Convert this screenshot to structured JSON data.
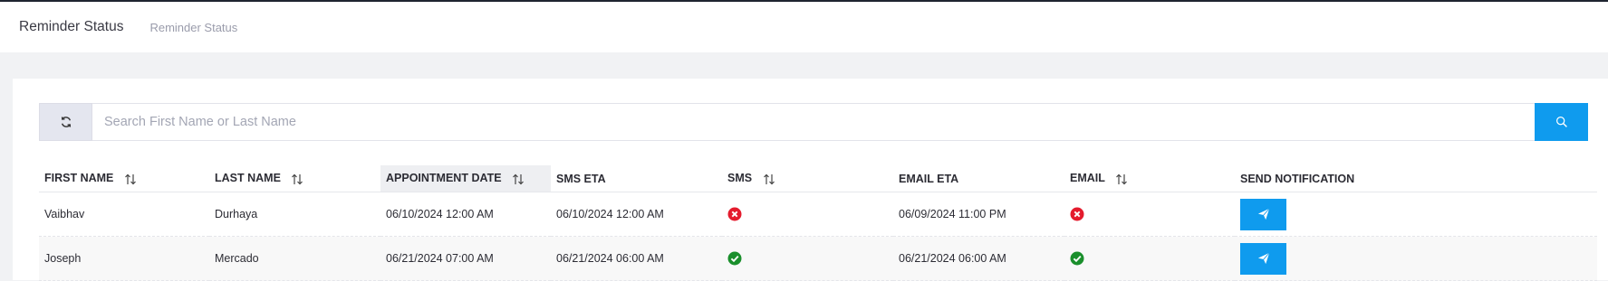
{
  "header": {
    "title": "Reminder Status",
    "breadcrumb": "Reminder Status"
  },
  "search": {
    "placeholder": "Search First Name or Last Name",
    "value": "",
    "refresh_icon": "refresh-icon",
    "search_icon": "search-icon"
  },
  "table": {
    "columns": [
      {
        "label": "FIRST NAME",
        "sortable": true
      },
      {
        "label": "LAST NAME",
        "sortable": true
      },
      {
        "label": "APPOINTMENT DATE",
        "sortable": true
      },
      {
        "label": "SMS ETA",
        "sortable": false
      },
      {
        "label": "SMS",
        "sortable": true
      },
      {
        "label": "EMAIL ETA",
        "sortable": false
      },
      {
        "label": "EMAIL",
        "sortable": true
      },
      {
        "label": "SEND NOTIFICATION",
        "sortable": false
      }
    ],
    "rows": [
      {
        "first_name": "Vaibhav",
        "last_name": "Durhaya",
        "appointment_date": "06/10/2024 12:00 AM",
        "sms_eta": "06/10/2024 12:00 AM",
        "sms_status": "failed",
        "email_eta": "06/09/2024 11:00 PM",
        "email_status": "failed"
      },
      {
        "first_name": "Joseph",
        "last_name": "Mercado",
        "appointment_date": "06/21/2024 07:00 AM",
        "sms_eta": "06/21/2024 06:00 AM",
        "sms_status": "sent",
        "email_eta": "06/21/2024 06:00 AM",
        "email_status": "sent"
      }
    ]
  },
  "colors": {
    "accent": "#0f9bee",
    "success": "#1a8f2c",
    "error": "#e41b2d"
  }
}
